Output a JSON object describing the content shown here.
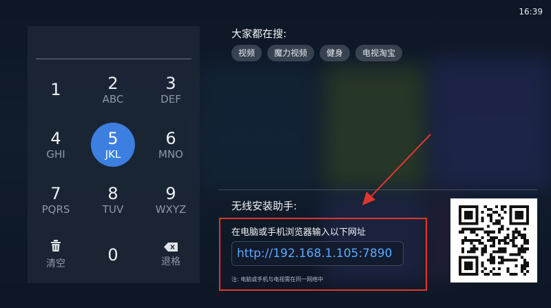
{
  "status_bar": {
    "time": "16:39"
  },
  "keypad": {
    "keys": [
      {
        "num": "1",
        "letters": ""
      },
      {
        "num": "2",
        "letters": "ABC"
      },
      {
        "num": "3",
        "letters": "DEF"
      },
      {
        "num": "4",
        "letters": "GHI"
      },
      {
        "num": "5",
        "letters": "JKL"
      },
      {
        "num": "6",
        "letters": "MNO"
      },
      {
        "num": "7",
        "letters": "PQRS"
      },
      {
        "num": "8",
        "letters": "TUV"
      },
      {
        "num": "9",
        "letters": "WXYZ"
      }
    ],
    "clear_label": "清空",
    "zero": "0",
    "delete_label": "退格",
    "active_key": "5"
  },
  "hot_search": {
    "title": "大家都在搜:",
    "tags": [
      "视频",
      "魔力视频",
      "健身",
      "电视淘宝"
    ]
  },
  "wireless_install": {
    "title": "无线安装助手:",
    "hint": "在电脑或手机浏览器输入以下网址",
    "url": "http://192.168.1.105:7890",
    "note": "注: 电脑或手机与电视需在同一网络中"
  },
  "colors": {
    "accent": "#3d7fe0",
    "highlight_box": "#e0362e",
    "url_text": "#5fa8ff"
  },
  "icons": {
    "clear": "trash-icon",
    "delete": "backspace-icon",
    "qr": "qr-code"
  }
}
